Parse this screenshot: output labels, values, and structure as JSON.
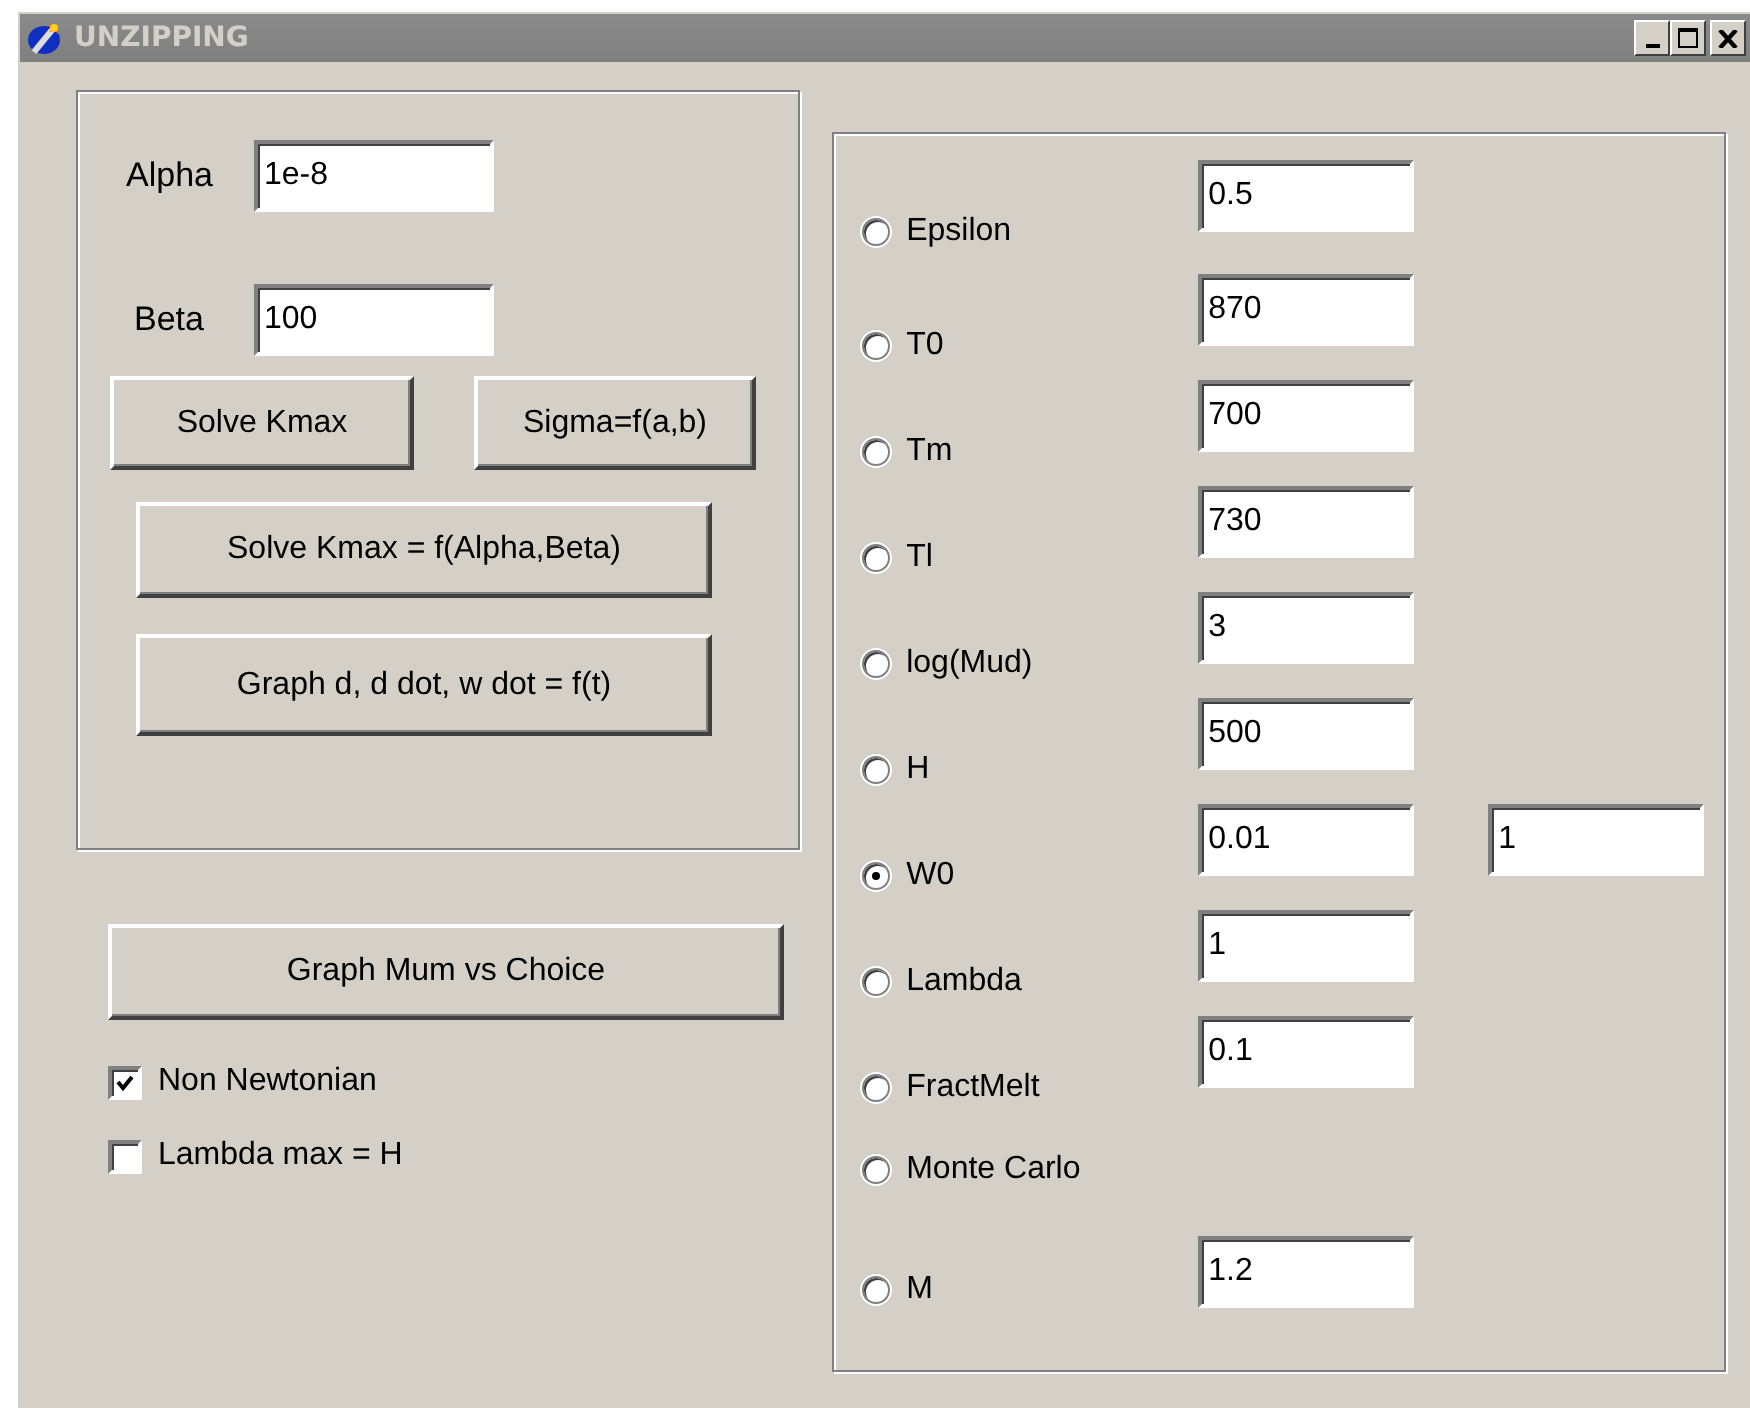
{
  "window": {
    "title": "UNZIPPING"
  },
  "parameters": [
    {
      "label": "Alpha",
      "value": "1e-8"
    },
    {
      "label": "Beta",
      "value": "100"
    }
  ],
  "solve_buttons": [
    "Solve Kmax",
    "Sigma=f(a,b)"
  ],
  "wide_buttons": [
    "Solve Kmax = f(Alpha,Beta)",
    "Graph d, d dot, w dot = f(t)"
  ],
  "graph_button": "Graph Mum vs Choice",
  "checkboxes": [
    {
      "label": "Non Newtonian",
      "checked": true
    },
    {
      "label": "Lambda max = H",
      "checked": false
    }
  ],
  "choices": [
    {
      "label": "Epsilon",
      "selected": false,
      "values": [
        "0.5"
      ]
    },
    {
      "label": "T0",
      "selected": false,
      "values": [
        "870"
      ]
    },
    {
      "label": "Tm",
      "selected": false,
      "values": [
        "700"
      ]
    },
    {
      "label": "Tl",
      "selected": false,
      "values": [
        "730"
      ]
    },
    {
      "label": "log(Mud)",
      "selected": false,
      "values": [
        "3"
      ]
    },
    {
      "label": "H",
      "selected": false,
      "values": [
        "500"
      ]
    },
    {
      "label": "W0",
      "selected": true,
      "values": [
        "0.01",
        "1"
      ]
    },
    {
      "label": "Lambda",
      "selected": false,
      "values": [
        "1"
      ]
    },
    {
      "label": "FractMelt",
      "selected": false,
      "values": [
        "0.1"
      ]
    },
    {
      "label": "Monte Carlo",
      "selected": false
    },
    {
      "label": "M",
      "selected": false,
      "values": [
        "1.2"
      ]
    }
  ]
}
